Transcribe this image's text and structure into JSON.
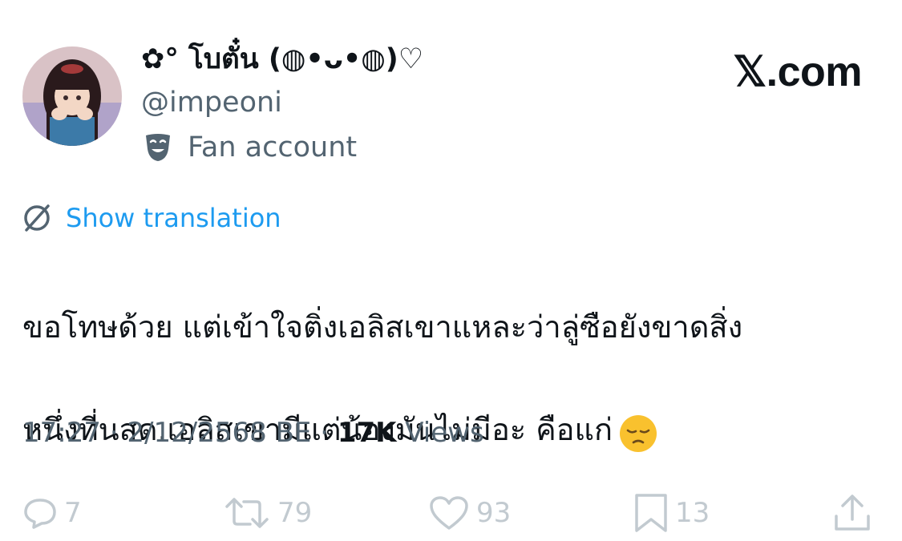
{
  "author": {
    "display_name": "✿° โบตั๋น (◍•ᴗ•◍)♡",
    "handle": "@impeoni",
    "badge_label": "Fan account",
    "badge_icon": "masks-icon"
  },
  "brand": {
    "label": "𝕏.com"
  },
  "translate": {
    "label": "Show translation",
    "icon": "translate-globe-icon"
  },
  "tweet": {
    "line1": "ขอโทษด้วย แต่เข้าใจติ่งเอลิสเขาแหละว่าลู่ซือยังขาดสิ่ง",
    "line2": "หนึ่งที่นสด.เอลิสเขามีแต่น้องมันไม่มีอะ คือแก่",
    "emoji": "pensive-face-emoji"
  },
  "meta": {
    "time": "17:27",
    "sep1": " · ",
    "date": "2/12/2568 BE",
    "sep2": " · ",
    "views_count": "17K",
    "views_label": " Views"
  },
  "actions": {
    "reply_count": "7",
    "repost_count": "79",
    "like_count": "93",
    "bookmark_count": "13"
  },
  "colors": {
    "text": "#0f1419",
    "secondary": "#536471",
    "link": "#1d9bf0",
    "action_icon": "#c2cad0"
  }
}
